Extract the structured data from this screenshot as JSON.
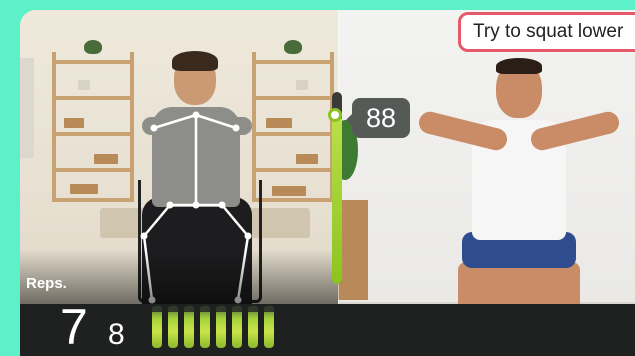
{
  "hint": {
    "text": "Try to squat lower"
  },
  "score": {
    "value": "88",
    "level": 0.88
  },
  "reps": {
    "label": "Reps.",
    "count": "7",
    "next": "8",
    "meter_bars": 8
  },
  "colors": {
    "accent_mint": "#5ef0c8",
    "meter_green": "#a6d13a",
    "hint_border": "#e45a6a"
  },
  "icons": {
    "user_skeleton": "pose-skeleton-overlay"
  }
}
